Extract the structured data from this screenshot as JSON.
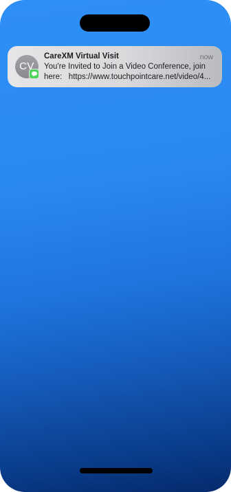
{
  "notification": {
    "avatar_initials": "CV",
    "app_icon": "messages-icon",
    "title": "CareXM Virtual Visit",
    "time": "now",
    "body_line1": "You're Invited to Join a Video Conference, join",
    "body_line2": "here:   https://www.touchpointcare.net/video/4..."
  },
  "colors": {
    "wallpaper_top": "#2e8ff6",
    "wallpaper_bottom": "#052a6c",
    "badge_green": "#4fd45d"
  }
}
